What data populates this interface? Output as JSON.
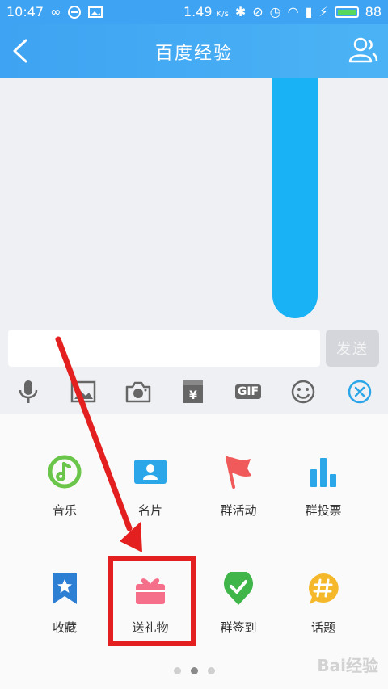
{
  "status_bar": {
    "time": "10:47",
    "speed": "1.49",
    "speed_unit": "K/s",
    "battery": "88"
  },
  "nav": {
    "title": "百度经验"
  },
  "input": {
    "placeholder": "",
    "value": "",
    "send_label": "发送"
  },
  "toolbar": {
    "gif_label": "GIF",
    "items": [
      "microphone-icon",
      "image-icon",
      "camera-icon",
      "red-packet-icon",
      "gif-icon",
      "emoji-icon",
      "close-circle-icon"
    ]
  },
  "panel": {
    "items": [
      {
        "label": "音乐",
        "icon": "music-icon",
        "color": "#6ac64a"
      },
      {
        "label": "名片",
        "icon": "contact-card-icon",
        "color": "#2ba6e8"
      },
      {
        "label": "群活动",
        "icon": "flag-icon",
        "color": "#f05a5a"
      },
      {
        "label": "群投票",
        "icon": "bar-chart-icon",
        "color": "#2ba6e8"
      },
      {
        "label": "收藏",
        "icon": "bookmark-star-icon",
        "color": "#2d7fd4"
      },
      {
        "label": "送礼物",
        "icon": "gift-icon",
        "color": "#f56f8a"
      },
      {
        "label": "群签到",
        "icon": "check-location-icon",
        "color": "#3fb54a"
      },
      {
        "label": "话题",
        "icon": "hashtag-bubble-icon",
        "color": "#f5b82a"
      }
    ],
    "page_count": 3,
    "active_page": 2
  },
  "watermark": "Bai经验",
  "colors": {
    "header": "#3ea3f2",
    "bubble": "#18b2f5",
    "highlight": "#e3201f"
  }
}
